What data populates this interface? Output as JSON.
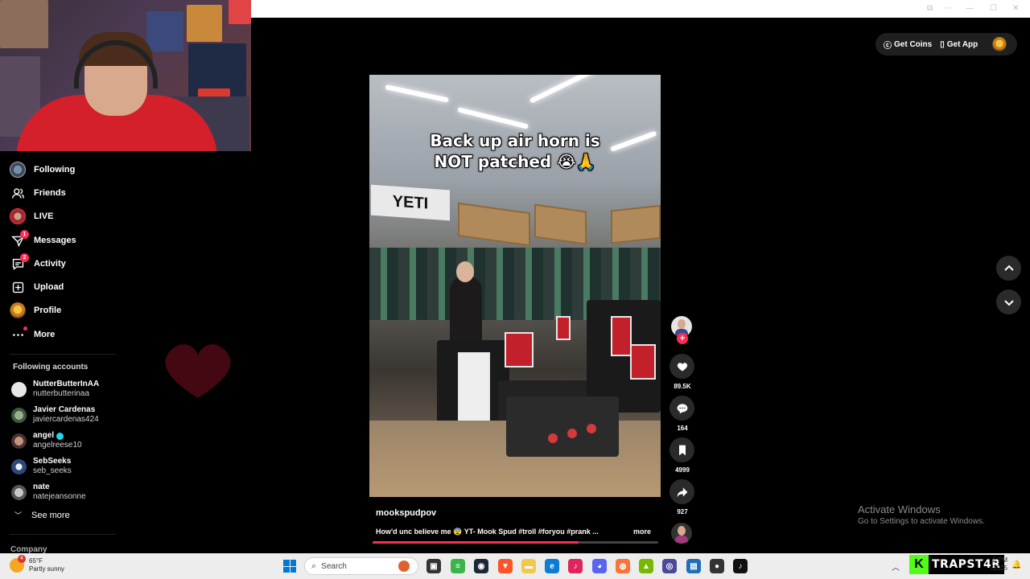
{
  "nav": {
    "items": [
      {
        "label": "Following"
      },
      {
        "label": "Friends"
      },
      {
        "label": "LIVE"
      },
      {
        "label": "Messages",
        "badge": "1"
      },
      {
        "label": "Activity",
        "badge": "2"
      },
      {
        "label": "Upload"
      },
      {
        "label": "Profile"
      },
      {
        "label": "More"
      }
    ]
  },
  "following": {
    "title": "Following accounts",
    "accounts": [
      {
        "name": "NutterButterInAA",
        "handle": "nutterbutterinaa"
      },
      {
        "name": "Javier Cardenas",
        "handle": "javiercardenas424"
      },
      {
        "name": "angel",
        "handle": "angelreese10",
        "verified": true
      },
      {
        "name": "SebSeeks",
        "handle": "seb_seeks"
      },
      {
        "name": "nate",
        "handle": "natejeansonne"
      }
    ],
    "see_more": "See more"
  },
  "company_label": "Company",
  "topright": {
    "coins": "Get Coins",
    "app": "Get App"
  },
  "video": {
    "caption_line1": "Back up air horn is",
    "caption_line2": "NOT patched 😭🙏",
    "store_sign": "YETI",
    "author": "mookspudpov",
    "description": "How'd unc believe me 😨 YT- Mook Spud  #troll #foryou #prank ...",
    "more": "more",
    "progress": 0.72
  },
  "actions": {
    "likes": "89.5K",
    "comments": "164",
    "saves": "4999",
    "shares": "927"
  },
  "activate": {
    "title": "Activate Windows",
    "subtitle": "Go to Settings to activate Windows."
  },
  "taskbar": {
    "temp": "65°F",
    "weather": "Partly sunny",
    "weather_badge": "4",
    "search": "Search",
    "time": "2 PM",
    "date": "/2025"
  },
  "overlay": {
    "streamer": "TRAPST4R",
    "logo_letter": "K"
  },
  "colors": {
    "accent": "#fe2c55",
    "kick_green": "#53fc18"
  }
}
